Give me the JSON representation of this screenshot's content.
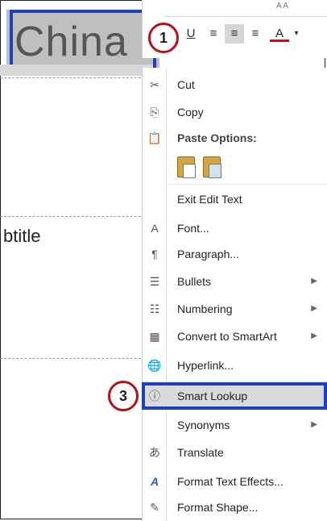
{
  "slide": {
    "title_text": "China",
    "subtitle_partial": "btitle"
  },
  "mini_toolbar": {
    "top_row_glyphs": "A  A",
    "underline_btn": "U",
    "font_color_btn": "A",
    "align_left_glyph": "≡",
    "align_center_glyph": "≡",
    "align_right_glyph": "≡",
    "dropdown_glyph": "▾"
  },
  "badges": {
    "first": "1",
    "third": "3"
  },
  "menu": {
    "items": [
      {
        "label": "Cut",
        "icon": "scissors-icon",
        "glyph": "✂",
        "submenu": false
      },
      {
        "label": "Copy",
        "icon": "copy-icon",
        "glyph": "⎘",
        "submenu": false
      },
      {
        "label": "Paste Options:",
        "icon": "paste-icon",
        "glyph": "📋",
        "submenu": false,
        "header": true
      },
      {
        "label": "",
        "icon": "paste-options-icons",
        "glyph": "",
        "submenu": false
      },
      {
        "label": "Exit Edit Text",
        "icon": "",
        "glyph": "",
        "submenu": false
      },
      {
        "label": "Font...",
        "icon": "font-icon",
        "glyph": "A",
        "submenu": false
      },
      {
        "label": "Paragraph...",
        "icon": "paragraph-icon",
        "glyph": "¶",
        "submenu": false
      },
      {
        "label": "Bullets",
        "icon": "bullets-icon",
        "glyph": "☰",
        "submenu": true
      },
      {
        "label": "Numbering",
        "icon": "numbering-icon",
        "glyph": "☷",
        "submenu": true
      },
      {
        "label": "Convert to SmartArt",
        "icon": "smartart-icon",
        "glyph": "▦",
        "submenu": true
      },
      {
        "label": "Hyperlink...",
        "icon": "hyperlink-icon",
        "glyph": "🌐",
        "submenu": false
      },
      {
        "label": "Smart Lookup",
        "icon": "smart-lookup-icon",
        "glyph": "ⓘ",
        "submenu": false
      },
      {
        "label": "Synonyms",
        "icon": "",
        "glyph": "",
        "submenu": true
      },
      {
        "label": "Translate",
        "icon": "translate-icon",
        "glyph": "あ",
        "submenu": false
      },
      {
        "label": "Format Text Effects...",
        "icon": "text-effects-icon",
        "glyph": "A",
        "submenu": false
      },
      {
        "label": "Format Shape...",
        "icon": "format-shape-icon",
        "glyph": "✎",
        "submenu": false
      }
    ],
    "submenu_arrow": "▶"
  },
  "colors": {
    "highlight_border": "#1f3fbf",
    "badge_border": "#b3121b",
    "font_color_bar": "#e00000"
  }
}
